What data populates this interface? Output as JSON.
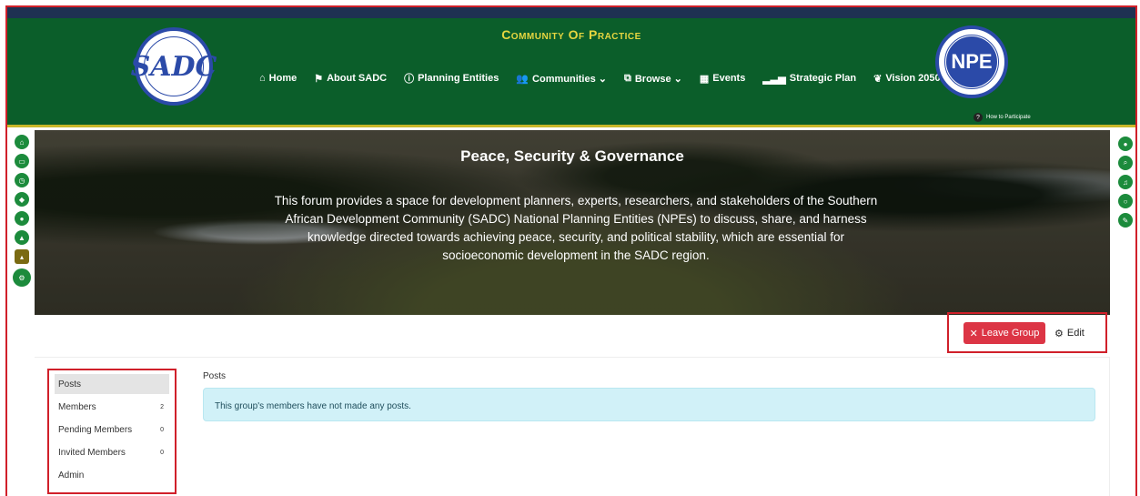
{
  "header": {
    "site_title": "Community Of Practice",
    "nav": [
      {
        "icon": "home-icon",
        "glyph": "⌂",
        "label": "Home"
      },
      {
        "icon": "flag-icon",
        "glyph": "⚑",
        "label": "About SADC"
      },
      {
        "icon": "info-icon",
        "glyph": "ⓘ",
        "label": "Planning Entities"
      },
      {
        "icon": "users-icon",
        "glyph": "👥",
        "label": "Communities ⌄"
      },
      {
        "icon": "browse-icon",
        "glyph": "⧉",
        "label": "Browse ⌄"
      },
      {
        "icon": "calendar-icon",
        "glyph": "▦",
        "label": "Events"
      },
      {
        "icon": "signal-icon",
        "glyph": "▂▃▅",
        "label": "Strategic Plan"
      },
      {
        "icon": "leaf-icon",
        "glyph": "❦",
        "label": "Vision 2050"
      }
    ],
    "how_to": "How to Participate",
    "left_logo": "SADC",
    "right_logo": "NPE"
  },
  "banner": {
    "title": "Peace, Security & Governance",
    "description": "This forum provides a space for development planners, experts, researchers, and stakeholders of the Southern African Development Community (SADC) National Planning Entities (NPEs) to discuss, share, and harness knowledge directed towards achieving peace, security, and political stability, which are essential for socioeconomic development in the SADC region."
  },
  "actions": {
    "leave_label": "Leave Group",
    "edit_label": "Edit"
  },
  "group_nav": [
    {
      "label": "Posts",
      "count": ""
    },
    {
      "label": "Members",
      "count": "2"
    },
    {
      "label": "Pending Members",
      "count": "0"
    },
    {
      "label": "Invited Members",
      "count": "0"
    },
    {
      "label": "Admin",
      "count": ""
    }
  ],
  "main": {
    "section_title": "Posts",
    "empty_message": "This group's members have not made any posts."
  },
  "colors": {
    "header_green": "#0b5e2a",
    "title_yellow": "#e6d640",
    "danger": "#dc3545",
    "info_bg": "#d1f1f8"
  }
}
